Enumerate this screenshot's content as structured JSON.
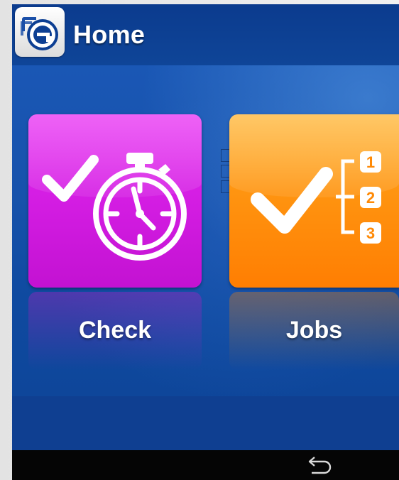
{
  "app": {
    "title": "Home",
    "logo_icon": "app-logo-icon",
    "accent_color": "#0f3d8a"
  },
  "tiles": [
    {
      "label": "Check",
      "icon": "check-stopwatch-icon",
      "color": "#d51ee4"
    },
    {
      "label": "Jobs",
      "icon": "check-numbered-list-icon",
      "color": "#ff9410",
      "list_numbers": [
        "1",
        "2",
        "3"
      ]
    }
  ],
  "nav": {
    "back_icon": "back-arrow-icon"
  }
}
